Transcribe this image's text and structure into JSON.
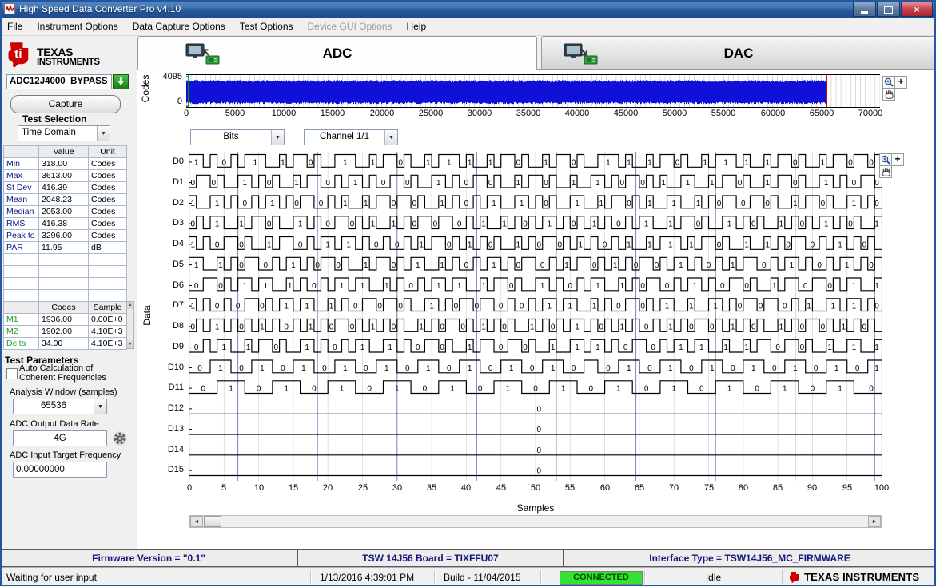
{
  "window_title": "High Speed Data Converter Pro v4.10",
  "menu": {
    "items": [
      {
        "label": "File",
        "enabled": true
      },
      {
        "label": "Instrument Options",
        "enabled": true
      },
      {
        "label": "Data Capture Options",
        "enabled": true
      },
      {
        "label": "Test Options",
        "enabled": true
      },
      {
        "label": "Device GUI Options",
        "enabled": false
      },
      {
        "label": "Help",
        "enabled": true
      }
    ]
  },
  "sidebar": {
    "brand_top": "TEXAS",
    "brand_bottom": "INSTRUMENTS",
    "device_value": "ADC12J4000_BYPASS",
    "capture_label": "Capture",
    "test_selection_label": "Test Selection",
    "test_selection_value": "Time Domain",
    "stats_table": {
      "headers": [
        "",
        "Value",
        "Unit"
      ],
      "rows": [
        [
          "Min",
          "318.00",
          "Codes"
        ],
        [
          "Max",
          "3613.00",
          "Codes"
        ],
        [
          "St Dev",
          "416.39",
          "Codes"
        ],
        [
          "Mean",
          "2048.23",
          "Codes"
        ],
        [
          "Median",
          "2053.00",
          "Codes"
        ],
        [
          "RMS",
          "416.38",
          "Codes"
        ],
        [
          "Peak to P",
          "3296.00",
          "Codes"
        ],
        [
          "PAR",
          "11.95",
          "dB"
        ]
      ],
      "blank_rows": 4,
      "headers2": [
        "",
        "Codes",
        "Sample"
      ],
      "marker_rows": [
        [
          "M1",
          "1936.00",
          "0.00E+0"
        ],
        [
          "M2",
          "1902.00",
          "4.10E+3"
        ],
        [
          "Delta",
          "34.00",
          "4.10E+3"
        ]
      ]
    },
    "test_parameters": {
      "heading": "Test Parameters",
      "auto_calc_line1": "Auto Calculation of",
      "auto_calc_line2": "Coherent Frequencies",
      "auto_calc_checked": false,
      "analysis_window_label": "Analysis Window (samples)",
      "analysis_window_value": "65536",
      "output_rate_label": "ADC Output Data Rate",
      "output_rate_value": "4G",
      "input_freq_label": "ADC Input Target Frequency",
      "input_freq_value": "0.00000000"
    }
  },
  "tabs": {
    "adc": "ADC",
    "dac": "DAC"
  },
  "toolbar": {
    "bits_value": "Bits",
    "channel_value": "Channel 1/1"
  },
  "chart_data": [
    {
      "id": "overview",
      "type": "area",
      "ylabel": "Codes",
      "yticks": [
        "4095",
        "0"
      ],
      "ylim": [
        0,
        4095
      ],
      "xlim": [
        0,
        71000
      ],
      "xticks": [
        0,
        5000,
        10000,
        15000,
        20000,
        25000,
        30000,
        35000,
        40000,
        45000,
        50000,
        55000,
        60000,
        65000,
        70000
      ],
      "samples": 65536,
      "min": 318,
      "max": 3613,
      "grid_step": 500,
      "line_color": "#1010d8",
      "marker_green": 250,
      "marker_red": 65536
    },
    {
      "id": "bits",
      "type": "digital",
      "ylabel": "Data",
      "xlabel": "Samples",
      "xlim": [
        0,
        100
      ],
      "xticks": [
        0,
        5,
        10,
        15,
        20,
        25,
        30,
        35,
        40,
        45,
        50,
        55,
        60,
        65,
        70,
        75,
        80,
        85,
        90,
        95,
        100
      ],
      "blue_gridlines": [
        7,
        18.5,
        30,
        41.5,
        53,
        64.5,
        76,
        87.5,
        99
      ],
      "rows": [
        {
          "name": "D0",
          "chunks": [
            "1101001011",
            "1001011010",
            "0111001011",
            "0100101110",
            "1001011010",
            "0101101001",
            "1101001011",
            "0100101110",
            "1001011010",
            "0101101101"
          ]
        },
        {
          "name": "D1",
          "chunks": [
            "0110100110",
            "1010010110",
            "0101101001",
            "1010011010",
            "0110100101",
            "1010010011",
            "0101101010",
            "0110010110",
            "1001011010",
            "0110100110"
          ]
        },
        {
          "name": "D2",
          "chunks": [
            "1001101001",
            "0110101100",
            "1010010110",
            "1101001010",
            "0101100110",
            "1010011001",
            "0110101001",
            "1001010110",
            "0110100101",
            "1010011010"
          ]
        },
        {
          "name": "D3",
          "chunks": [
            "0101100101",
            "1010011010",
            "0110101001",
            "0101101100",
            "1010010101",
            "0110101010",
            "1001011001",
            "0110100110",
            "1010010101",
            "0110101001"
          ]
        },
        {
          "name": "D4",
          "chunks": [
            "1010011010",
            "0101100101",
            "1011010010",
            "0101011010",
            "1010100101",
            "0110101010",
            "0101001011",
            "1010110100",
            "1001010110",
            "0101101010"
          ]
        },
        {
          "name": "D5",
          "chunks": [
            "1100101011",
            "0010110101",
            "1010010110",
            "1011001010",
            "0101101011",
            "0010101101",
            "0101011010",
            "1101001010",
            "1100101101",
            "0010110101"
          ]
        },
        {
          "name": "D6",
          "chunks": [
            "0011010110",
            "1100101001",
            "0110110010",
            "1001011011",
            "0010110100",
            "1101001011",
            "0010101100",
            "1011010011",
            "0100101100",
            "1101011001"
          ]
        },
        {
          "name": "D7",
          "chunks": [
            "1010010011",
            "0101101100",
            "1010011011",
            "0100110101",
            "1011001001",
            "0110110010",
            "1001101011",
            "0010011010",
            "1101100101",
            "0011011010"
          ]
        },
        {
          "name": "D8",
          "chunks": [
            "0101101010",
            "1010010101",
            "0110101010",
            "1001010110",
            "1010101001",
            "0101011010",
            "1010100101",
            "0101101010",
            "1010010101",
            "1010101010"
          ]
        },
        {
          "name": "D9",
          "chunks": [
            "0010110010",
            "1101001101",
            "0010110011",
            "0100110100",
            "1011001101",
            "0010011011",
            "0100110010",
            "1101100100",
            "1011001101",
            "0010011001"
          ]
        },
        {
          "name": "D10",
          "chunks": [
            "0001110001",
            "1100011100",
            "0111000111",
            "0001110001",
            "1100011100",
            "0111000110",
            "0011100011",
            "1000111000",
            "1110001110",
            "0011100011"
          ]
        },
        {
          "name": "D11",
          "chunks": [
            "0000111100",
            "0011110000",
            "1111000011",
            "1100001111",
            "0000111100",
            "0011110000",
            "1111000011",
            "1100001111",
            "0000111100",
            "0011110000"
          ]
        },
        {
          "name": "D12",
          "chunks": [
            "0000000000"
          ]
        },
        {
          "name": "D13",
          "chunks": [
            "0000000000"
          ]
        },
        {
          "name": "D14",
          "chunks": [
            "0000000000"
          ]
        },
        {
          "name": "D15",
          "chunks": [
            "0000000000"
          ]
        }
      ]
    }
  ],
  "footer": {
    "firmware": "Firmware Version = \"0.1\"",
    "board": "TSW 14J56 Board = TIXFFU07",
    "interface": "Interface Type = TSW14J56_MC_FIRMWARE"
  },
  "statusbar": {
    "status": "Waiting for user input",
    "datetime": "1/13/2016 4:39:01 PM",
    "build": "Build - 11/04/2015",
    "connection": "CONNECTED",
    "state": "Idle",
    "brand": "TEXAS INSTRUMENTS"
  }
}
